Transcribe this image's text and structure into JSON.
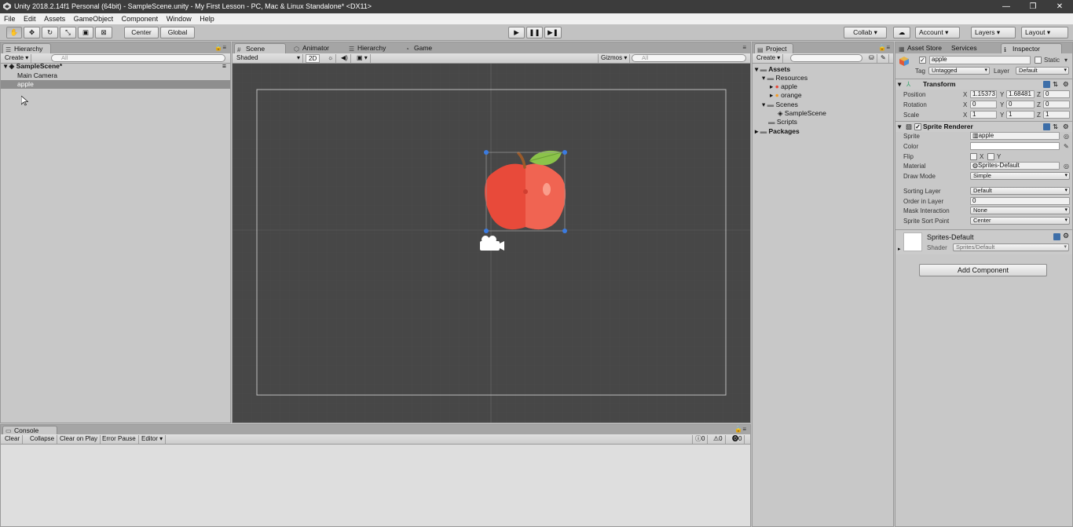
{
  "window": {
    "title": "Unity 2018.2.14f1 Personal (64bit) - SampleScene.unity - My First Lesson - PC, Mac & Linux Standalone* <DX11>"
  },
  "menu": [
    "File",
    "Edit",
    "Assets",
    "GameObject",
    "Component",
    "Window",
    "Help"
  ],
  "toolbar": {
    "center_label": "Center",
    "global_label": "Global",
    "collab_label": "Collab ▾",
    "account_label": "Account",
    "layers_label": "Layers",
    "layout_label": "Layout"
  },
  "hierarchy": {
    "tab": "Hierarchy",
    "create": "Create",
    "search_placeholder": "All",
    "scene": "SampleScene*",
    "items": [
      "Main Camera",
      "apple"
    ]
  },
  "scene_tabs": {
    "scene": "Scene",
    "animator": "Animator",
    "hierarchy": "Hierarchy",
    "game": "Game"
  },
  "scene_toolbar": {
    "shading": "Shaded",
    "mode2d": "2D",
    "gizmos": "Gizmos",
    "search_placeholder": "All"
  },
  "project": {
    "tab": "Project",
    "create": "Create",
    "tree": {
      "assets": "Assets",
      "resources": "Resources",
      "apple": "apple",
      "orange": "orange",
      "scenes": "Scenes",
      "sample_scene": "SampleScene",
      "scripts": "Scripts",
      "packages": "Packages"
    }
  },
  "inspector": {
    "tabs": {
      "asset_store": "Asset Store",
      "services": "Services",
      "inspector": "Inspector"
    },
    "object_name": "apple",
    "static_label": "Static",
    "tag_label": "Tag",
    "tag_value": "Untagged",
    "layer_label": "Layer",
    "layer_value": "Default",
    "transform": {
      "title": "Transform",
      "position_label": "Position",
      "rotation_label": "Rotation",
      "scale_label": "Scale",
      "position": {
        "x": "1.15373",
        "y": "1.68481",
        "z": "0"
      },
      "rotation": {
        "x": "0",
        "y": "0",
        "z": "0"
      },
      "scale": {
        "x": "1",
        "y": "1",
        "z": "1"
      }
    },
    "axis": {
      "x": "X",
      "y": "Y",
      "z": "Z"
    },
    "sprite_renderer": {
      "title": "Sprite Renderer",
      "sprite_label": "Sprite",
      "sprite_value": "apple",
      "color_label": "Color",
      "flip_label": "Flip",
      "flip_x": "X",
      "flip_y": "Y",
      "material_label": "Material",
      "material_value": "Sprites-Default",
      "draw_mode_label": "Draw Mode",
      "draw_mode_value": "Simple",
      "sorting_layer_label": "Sorting Layer",
      "sorting_layer_value": "Default",
      "order_label": "Order in Layer",
      "order_value": "0",
      "mask_label": "Mask Interaction",
      "mask_value": "None",
      "sort_point_label": "Sprite Sort Point",
      "sort_point_value": "Center"
    },
    "material": {
      "name": "Sprites-Default",
      "shader_label": "Shader",
      "shader_value": "Sprites/Default"
    },
    "add_component": "Add Component"
  },
  "console": {
    "tab": "Console",
    "clear": "Clear",
    "collapse": "Collapse",
    "clear_on_play": "Clear on Play",
    "error_pause": "Error Pause",
    "editor": "Editor",
    "info_count": "0",
    "warn_count": "0",
    "error_count": "0"
  },
  "colors": {
    "scene_bg": "#474747",
    "panel": "#c8c8c8",
    "selection": "#8e8e8e",
    "apple": "#ea4b3b"
  }
}
